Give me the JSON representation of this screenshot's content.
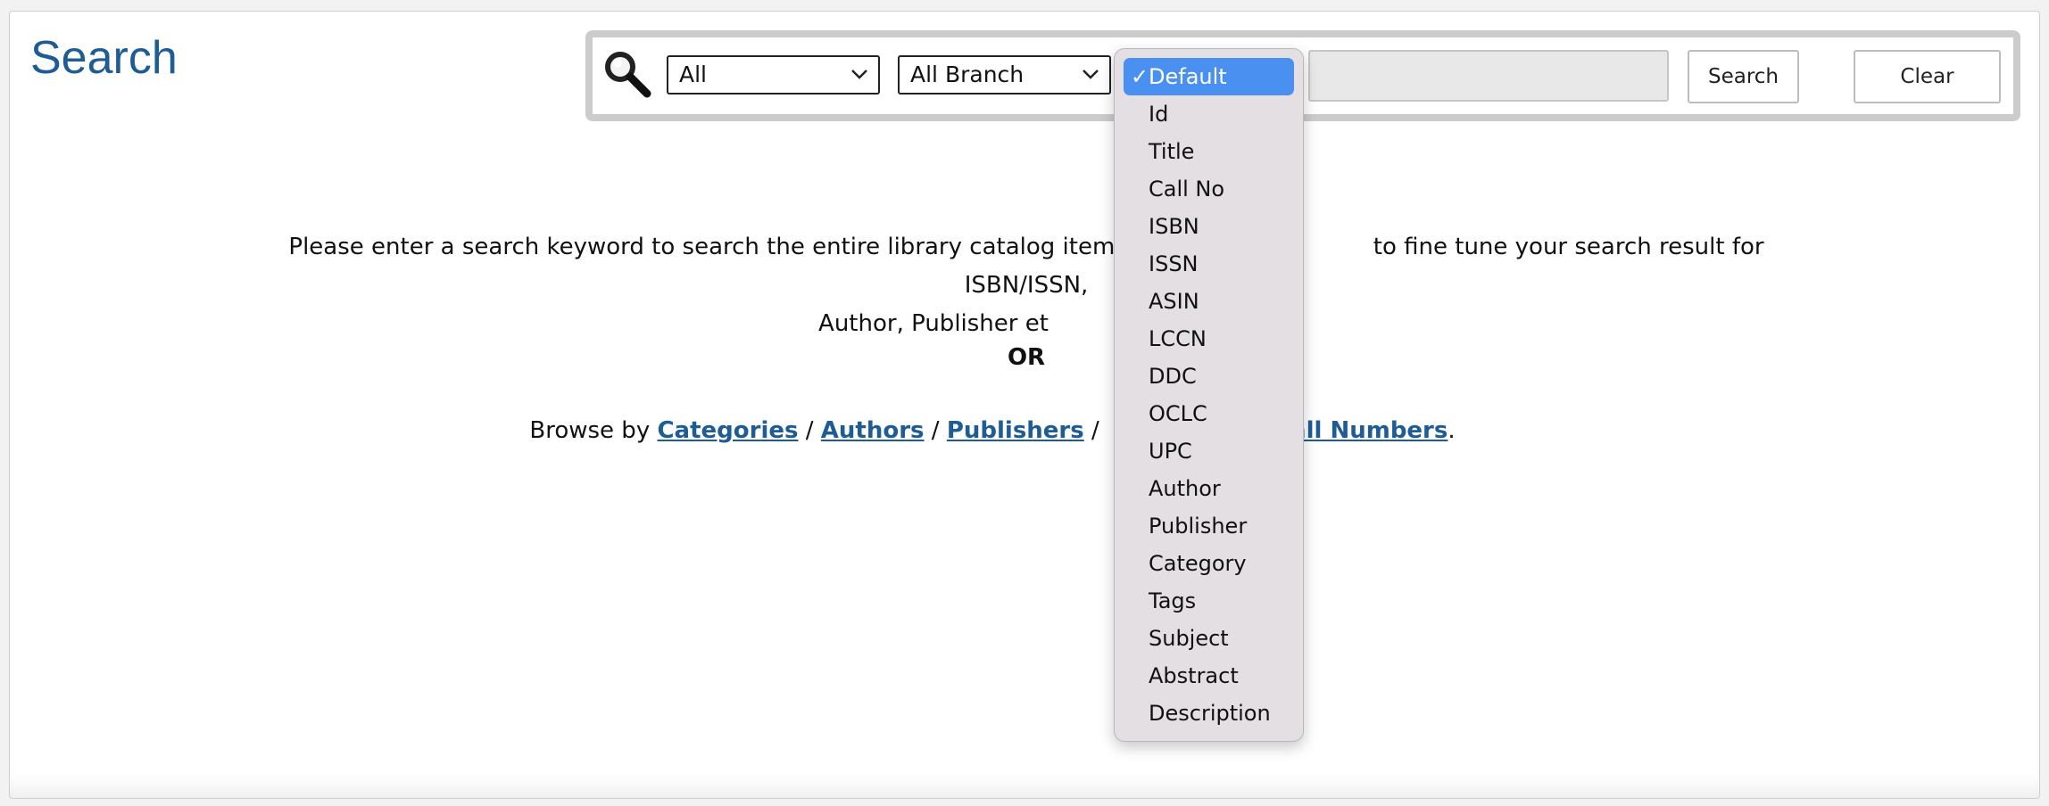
{
  "page": {
    "title": "Search"
  },
  "search": {
    "type_select": "All",
    "branch_select": "All Branch",
    "search_button": "Search",
    "clear_button": "Clear"
  },
  "field_dropdown": {
    "selected": "Default",
    "check": "✓",
    "options": [
      "Default",
      "Id",
      "Title",
      "Call No",
      "ISBN",
      "ISSN",
      "ASIN",
      "LCCN",
      "DDC",
      "OCLC",
      "UPC",
      "Author",
      "Publisher",
      "Category",
      "Tags",
      "Subject",
      "Abstract",
      "Description"
    ]
  },
  "info": {
    "line1_start": "Please enter a search keyword to search the entire library catalog items. Use spe",
    "line1_end": "to fine tune your search result for ISBN/ISSN,",
    "line2_start": "Author, Publisher et",
    "or": "OR"
  },
  "browse": {
    "prefix": "Browse by ",
    "categories": "Categories",
    "authors": "Authors",
    "publishers": "Publishers",
    "call_numbers": "all Numbers",
    "sep": " / ",
    "period": "."
  },
  "colors": {
    "title": "#1e5c96",
    "link": "#1e5c96",
    "dropdown_bg": "#e3dfe3",
    "selected_bg": "#4a90f0"
  },
  "icons": {
    "search": "magnifier-icon",
    "select": "chevron-down-icon",
    "check": "checkmark-icon"
  }
}
